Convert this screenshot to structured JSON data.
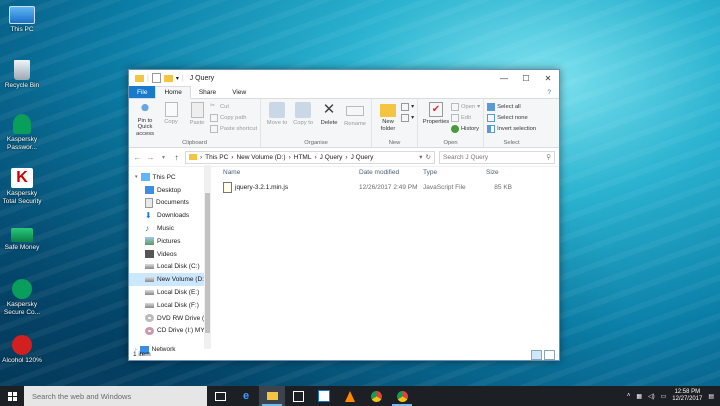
{
  "desktop": {
    "icons": [
      {
        "label": "This PC"
      },
      {
        "label": "Recycle Bin"
      },
      {
        "label": "Kaspersky Passwor..."
      },
      {
        "label": "Kaspersky Total Security"
      },
      {
        "label": "Safe Money"
      },
      {
        "label": "Kaspersky Secure Co..."
      },
      {
        "label": "Alcohol 120%"
      }
    ]
  },
  "window": {
    "title": "J Query",
    "controls": {
      "minimize": "—",
      "maximize": "☐",
      "close": "✕"
    },
    "ribbon_tabs": [
      "File",
      "Home",
      "Share",
      "View"
    ],
    "ribbon": {
      "clipboard": {
        "pin_label": "Pin to Quick access",
        "copy_label": "Copy",
        "paste_label": "Paste",
        "cut_label": "Cut",
        "copy_path_label": "Copy path",
        "paste_shortcut_label": "Paste shortcut",
        "group_label": "Clipboard"
      },
      "organise": {
        "move_to_label": "Move to",
        "copy_to_label": "Copy to",
        "delete_label": "Delete",
        "rename_label": "Rename",
        "group_label": "Organise"
      },
      "new": {
        "new_folder_label": "New folder",
        "group_label": "New"
      },
      "open": {
        "properties_label": "Properties",
        "open_label": "Open",
        "edit_label": "Edit",
        "history_label": "History",
        "group_label": "Open"
      },
      "select": {
        "select_all_label": "Select all",
        "select_none_label": "Select none",
        "invert_label": "Invert selection",
        "group_label": "Select"
      }
    },
    "address": {
      "crumbs": [
        "This PC",
        "New Volume (D:)",
        "HTML",
        "J Query",
        "J Query"
      ],
      "search_placeholder": "Search J Query"
    },
    "nav_pane": {
      "items": [
        {
          "label": "This PC"
        },
        {
          "label": "Desktop"
        },
        {
          "label": "Documents"
        },
        {
          "label": "Downloads"
        },
        {
          "label": "Music"
        },
        {
          "label": "Pictures"
        },
        {
          "label": "Videos"
        },
        {
          "label": "Local Disk (C:)"
        },
        {
          "label": "New Volume (D:"
        },
        {
          "label": "Local Disk (E:)"
        },
        {
          "label": "Local Disk (F:)"
        },
        {
          "label": "DVD RW Drive (C"
        },
        {
          "label": "CD Drive (I:) MY("
        },
        {
          "label": "Network"
        }
      ]
    },
    "columns": {
      "name": "Name",
      "date": "Date modified",
      "type": "Type",
      "size": "Size"
    },
    "files": [
      {
        "name": "jquery-3.2.1.min.js",
        "date": "12/26/2017 2:49 PM",
        "type": "JavaScript File",
        "size": "85 KB"
      }
    ],
    "status": "1 item"
  },
  "taskbar": {
    "search_placeholder": "Search the web and Windows",
    "time": "12:58 PM",
    "date": "12/27/2017"
  },
  "colors": {
    "accent": "#1979ca",
    "selection": "#cce8ff",
    "taskbar": "#1c1f24"
  }
}
